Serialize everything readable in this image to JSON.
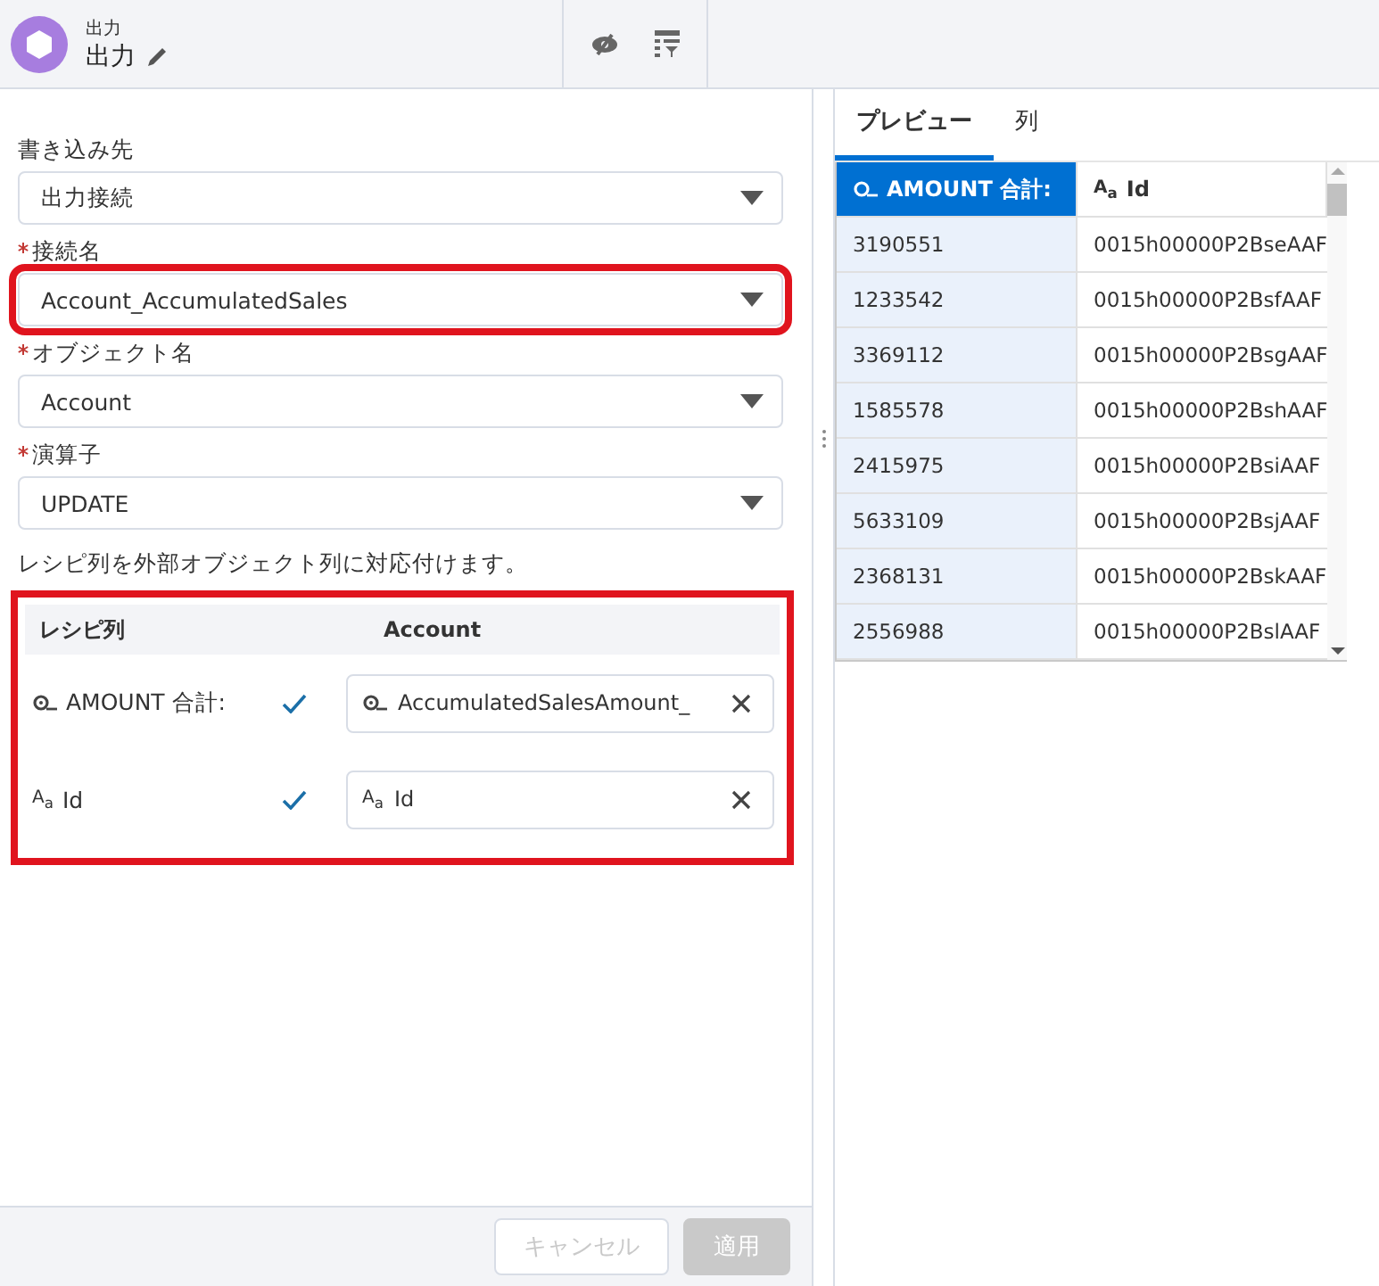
{
  "header": {
    "subtitle": "出力",
    "title": "出力"
  },
  "fields": [
    {
      "label": "書き込み先",
      "required": false,
      "value": "出力接続",
      "highlighted": false
    },
    {
      "label": "接続名",
      "required": true,
      "value": "Account_AccumulatedSales",
      "highlighted": true
    },
    {
      "label": "オブジェクト名",
      "required": true,
      "value": "Account",
      "highlighted": false
    },
    {
      "label": "演算子",
      "required": true,
      "value": "UPDATE",
      "highlighted": false
    }
  ],
  "mapping_hint": "レシピ列を外部オブジェクト列に対応付けます。",
  "mapping": {
    "highlighted": true,
    "columns": [
      "レシピ列",
      "Account"
    ],
    "rows": [
      {
        "kind": "measure",
        "source": "AMOUNT 合計:",
        "mapped": true,
        "target": "AccumulatedSalesAmount_"
      },
      {
        "kind": "text",
        "type_icon": "A$_{a}$",
        "source": "Id",
        "mapped": true,
        "target_type_icon": "A$_{a}$",
        "target": "Id"
      }
    ]
  },
  "footer": {
    "buttons": [
      {
        "label": "キャンセル",
        "kind": "outline",
        "disabled": true
      },
      {
        "label": "適用",
        "kind": "brand",
        "disabled": true
      }
    ]
  },
  "tabs": [
    {
      "label": "プレビュー",
      "selected": true
    },
    {
      "label": "列",
      "selected": false
    }
  ],
  "table": {
    "columns": [
      {
        "kind": "measure",
        "label": "AMOUNT 合計:",
        "selected": true
      },
      {
        "kind": "text",
        "type_icon": "A$_{a}$",
        "label": "Id",
        "selected": false
      }
    ],
    "rows": [
      [
        "3190551",
        "0015h00000P2BseAAF"
      ],
      [
        "1233542",
        "0015h00000P2BsfAAF"
      ],
      [
        "3369112",
        "0015h00000P2BsgAAF"
      ],
      [
        "1585578",
        "0015h00000P2BshAAF"
      ],
      [
        "2415975",
        "0015h00000P2BsiAAF"
      ],
      [
        "5633109",
        "0015h00000P2BsjAAF"
      ],
      [
        "2368131",
        "0015h00000P2BskAAF"
      ],
      [
        "2556988",
        "0015h00000P2BslAAF"
      ]
    ]
  }
}
